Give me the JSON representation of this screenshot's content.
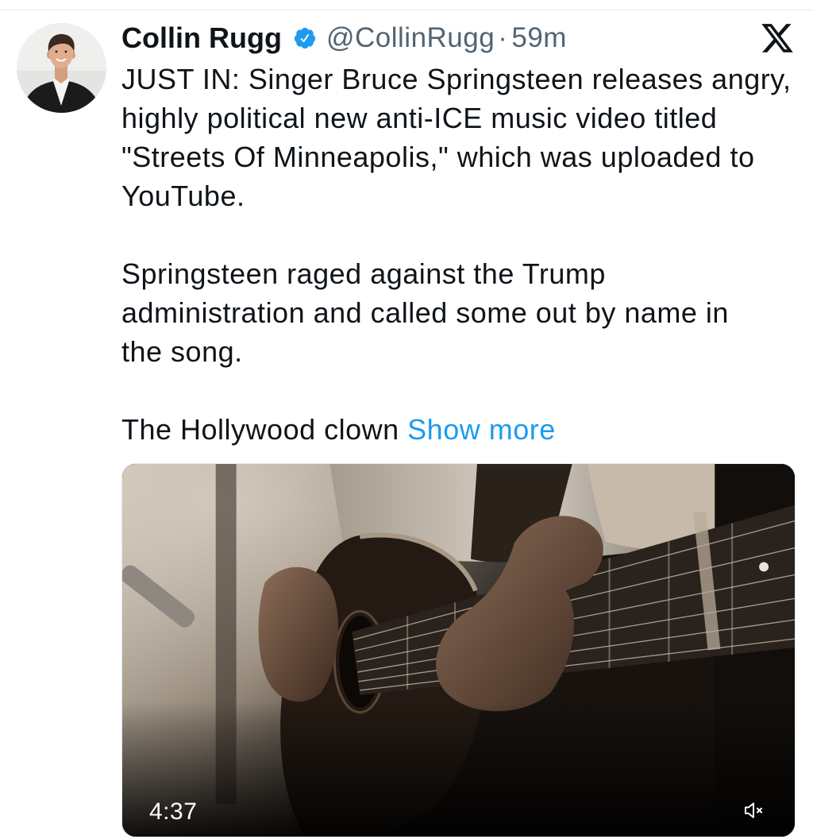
{
  "tweet": {
    "author": {
      "name": "Collin Rugg",
      "handle": "@CollinRugg",
      "verified": true
    },
    "separator": "·",
    "timestamp": "59m",
    "text": {
      "paragraphs": [
        "JUST IN: Singer Bruce Springsteen releases angry,\nhighly political new anti-ICE music video titled\n\"Streets Of Minneapolis,\" which was uploaded to\nYouTube.",
        "Springsteen raged against the Trump\nadministration and called some out by name in\nthe song.",
        "The Hollywood clown"
      ],
      "show_more": "Show more"
    },
    "media": {
      "type": "video",
      "duration": "4:37",
      "muted": true
    }
  },
  "colors": {
    "text": "#0f1419",
    "secondary_text": "#536471",
    "link": "#1d9bf0",
    "verified_badge": "#1d9bf0",
    "background": "#ffffff"
  },
  "icons": {
    "verified": "verified-badge-icon",
    "platform_logo": "x-logo-icon",
    "volume": "muted-speaker-icon"
  }
}
